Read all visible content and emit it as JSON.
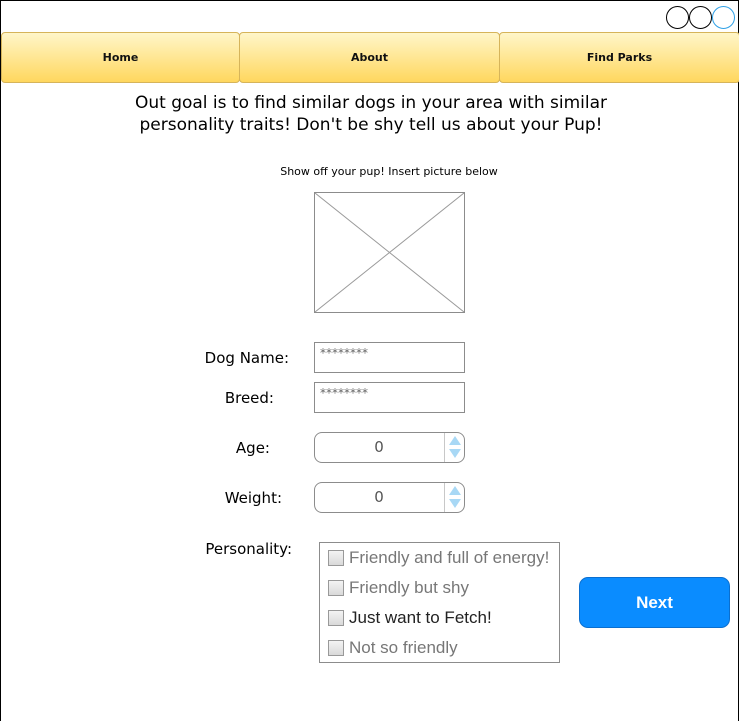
{
  "nav": {
    "home": "Home",
    "about": "About",
    "find_parks": "Find Parks"
  },
  "intro_text": "Out goal is to find similar dogs in your area with similar personality traits! Don't be shy tell us about your Pup!",
  "picture": {
    "label": "Show off your pup! Insert picture below"
  },
  "form": {
    "dog_name_label": "Dog Name:",
    "dog_name_value": "********",
    "breed_label": "Breed:",
    "breed_value": "********",
    "age_label": "Age:",
    "age_value": "0",
    "weight_label": "Weight:",
    "weight_value": "0",
    "personality_label": "Personality:",
    "personality_options": [
      {
        "label": "Friendly and full of energy!",
        "checked": false
      },
      {
        "label": "Friendly but shy",
        "checked": false
      },
      {
        "label": "Just want to Fetch!",
        "checked": false
      },
      {
        "label": "Not so friendly",
        "checked": false
      }
    ]
  },
  "next_button": "Next",
  "colors": {
    "nav_gradient_top": "#fff6c9",
    "nav_gradient_bottom": "#ffd75e",
    "primary_button": "#0a8cff",
    "stepper_arrow": "#a8d8f5"
  },
  "icons": {
    "window_controls": [
      "circle",
      "circle",
      "circle"
    ],
    "image_placeholder": "image-placeholder-icon",
    "stepper": [
      "arrow-up-icon",
      "arrow-down-icon"
    ]
  }
}
